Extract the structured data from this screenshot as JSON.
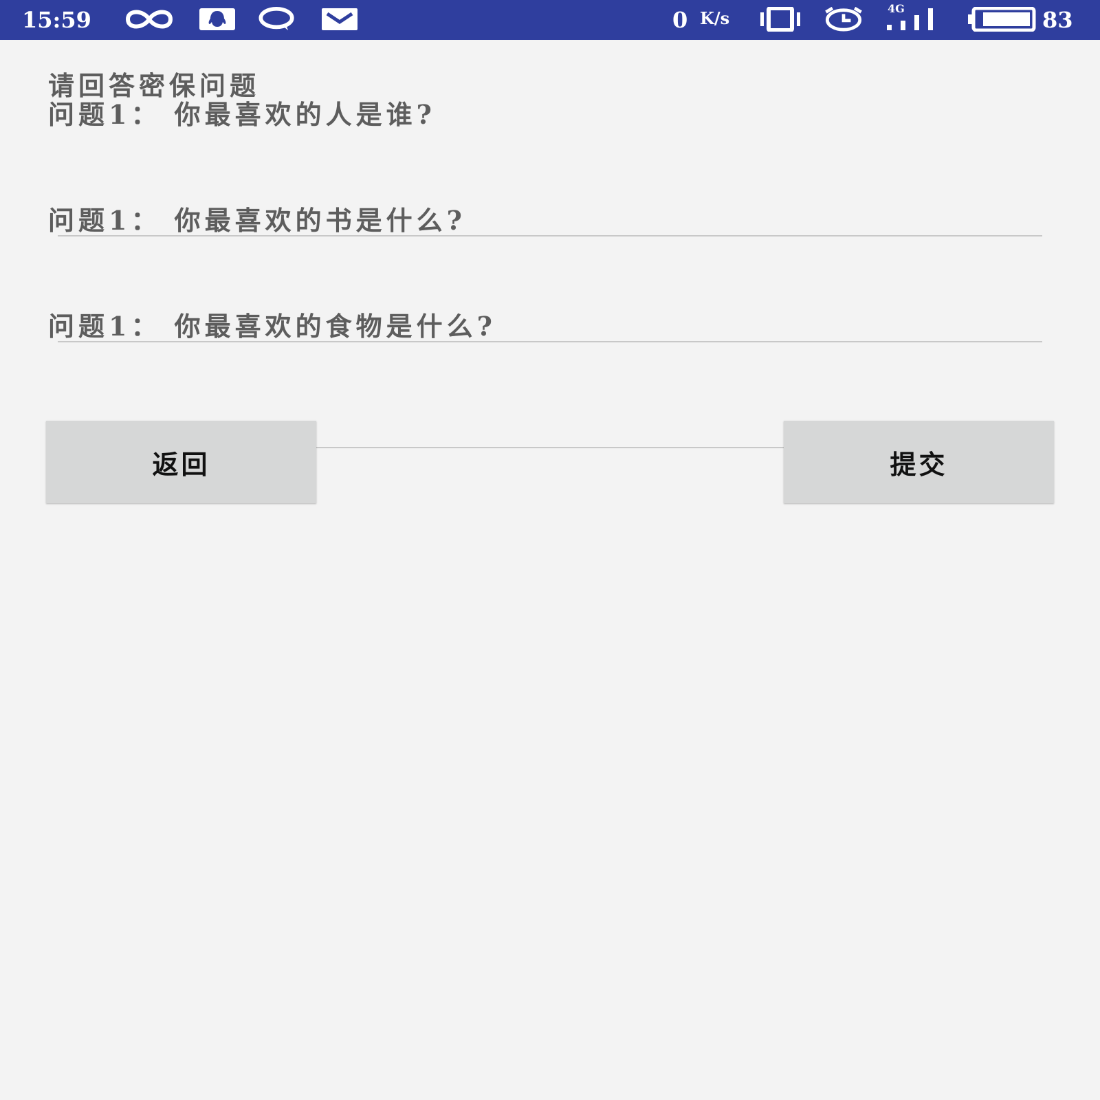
{
  "status_bar": {
    "time": "15:59",
    "net_speed_value": "0",
    "net_speed_unit": "K/s",
    "network_type": "4G",
    "battery_level": "83",
    "icons": [
      "infinity-icon",
      "qq-icon",
      "chat-bubble-icon",
      "mail-icon",
      "vibrate-icon",
      "alarm-icon",
      "signal-icon",
      "battery-icon"
    ],
    "background_color": "#2f3e9e"
  },
  "page": {
    "title": "请回答密保问题",
    "questions": [
      {
        "label": "问题1：  你最喜欢的人是谁?",
        "value": ""
      },
      {
        "label": "问题1：  你最喜欢的书是什么?",
        "value": ""
      },
      {
        "label": "问题1：  你最喜欢的食物是什么?",
        "value": ""
      }
    ]
  },
  "buttons": {
    "back_label": "返回",
    "submit_label": "提交"
  }
}
